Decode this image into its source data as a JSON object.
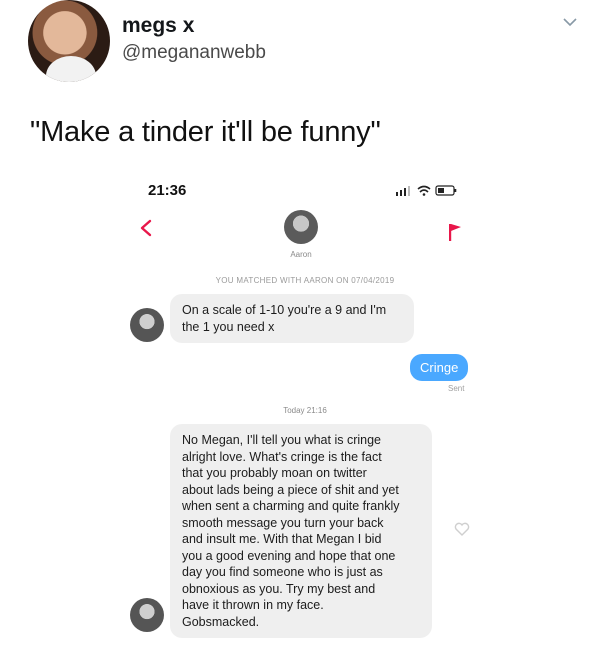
{
  "tweet": {
    "display_name": "megs x",
    "handle": "@megananwebb",
    "text": "\"Make a tinder it'll be funny\""
  },
  "phone": {
    "time": "21:36",
    "match_name": "Aaron",
    "matched_note": "YOU MATCHED WITH AARON ON 07/04/2019",
    "messages": [
      {
        "direction": "in",
        "lines": [
          "On a scale of 1-10 you're a 9 and I'm",
          "the 1 you need x"
        ]
      },
      {
        "direction": "out",
        "text": "Cringe",
        "status": "Sent"
      },
      {
        "direction": "in",
        "lines": [
          "No Megan, I'll tell you what is cringe",
          "alright love.  What's cringe is the fact",
          "that you probably moan on twitter",
          "about lads being a piece of shit and yet",
          "when sent a charming and quite frankly",
          "smooth message you turn your back",
          "and insult me. With that Megan I bid",
          "you a good evening and hope that one",
          "day you find someone who is just as",
          "obnoxious as you. Try my best and",
          "have it thrown in my face.",
          "Gobsmacked."
        ]
      }
    ],
    "today_label": "Today 21:16"
  },
  "colors": {
    "bubble_out": "#4aa8ff",
    "flag": "#e8174a"
  }
}
